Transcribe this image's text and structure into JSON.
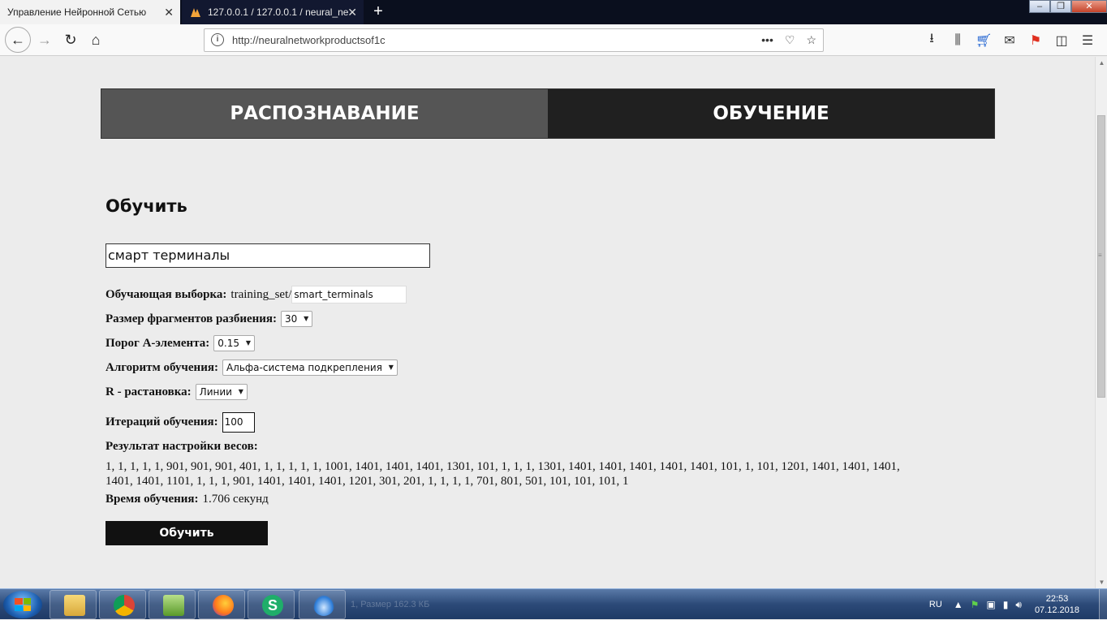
{
  "browser": {
    "active_tab_title": "Управление Нейронной Сетью",
    "inactive_tab_title": "127.0.0.1 / 127.0.0.1 / neural_ne",
    "new_tab_symbol": "+",
    "url": "http://neuralnetworkproductsof1c",
    "icons": [
      "back-icon",
      "forward-icon",
      "reload-icon",
      "home-icon",
      "info-icon",
      "more-icon",
      "pocket-icon",
      "bookmark-star-icon",
      "download-icon",
      "library-icon",
      "cart-icon",
      "mail-icon",
      "flag-icon",
      "sidebar-icon",
      "menu-icon"
    ]
  },
  "page": {
    "menu": {
      "recognition": "РАСПОЗНАВАНИЕ",
      "training": "ОБУЧЕНИЕ"
    },
    "heading": "Обучить",
    "class_name_value": "смарт терминалы",
    "training_set": {
      "label": "Обучающая выборка:",
      "prefix": "training_set/",
      "value": "smart_terminals"
    },
    "fragment_size": {
      "label": "Размер фрагментов разбиения:",
      "value": "30"
    },
    "a_threshold": {
      "label": "Порог А-элемента:",
      "value": "0.15"
    },
    "algorithm": {
      "label": "Алгоритм обучения:",
      "value": "Альфа-система подкрепления"
    },
    "r_layout": {
      "label": "R - растановка:",
      "value": "Линии"
    },
    "iterations": {
      "label": "Итераций обучения:",
      "value": "100"
    },
    "weights": {
      "label": "Результат настройки весов:",
      "value": "1, 1, 1, 1, 1, 901, 901, 901, 401, 1, 1, 1, 1, 1, 1001, 1401, 1401, 1401, 1301, 101, 1, 1, 1, 1301, 1401, 1401, 1401, 1401, 1401, 101, 1, 101, 1201, 1401, 1401, 1401, 1401, 1401, 1101, 1, 1, 1, 901, 1401, 1401, 1401, 1201, 301, 201, 1, 1, 1, 1, 701, 801, 501, 101, 101, 101, 1"
    },
    "training_time": {
      "label": "Время обучения:",
      "value": "1.706 секунд"
    },
    "train_button": "Обучить"
  },
  "taskbar": {
    "ghost_text": "1, Размер 162.3 КБ",
    "language": "RU",
    "time": "22:53",
    "date": "07.12.2018",
    "apps": [
      "explorer",
      "chrome",
      "notepad-plus-plus",
      "firefox",
      "s-app",
      "cloud-app"
    ]
  },
  "colors": {
    "menu_recognition_bg": "#555555",
    "menu_training_bg": "#202020",
    "button_bg": "#111111",
    "page_bg": "#ececec"
  }
}
